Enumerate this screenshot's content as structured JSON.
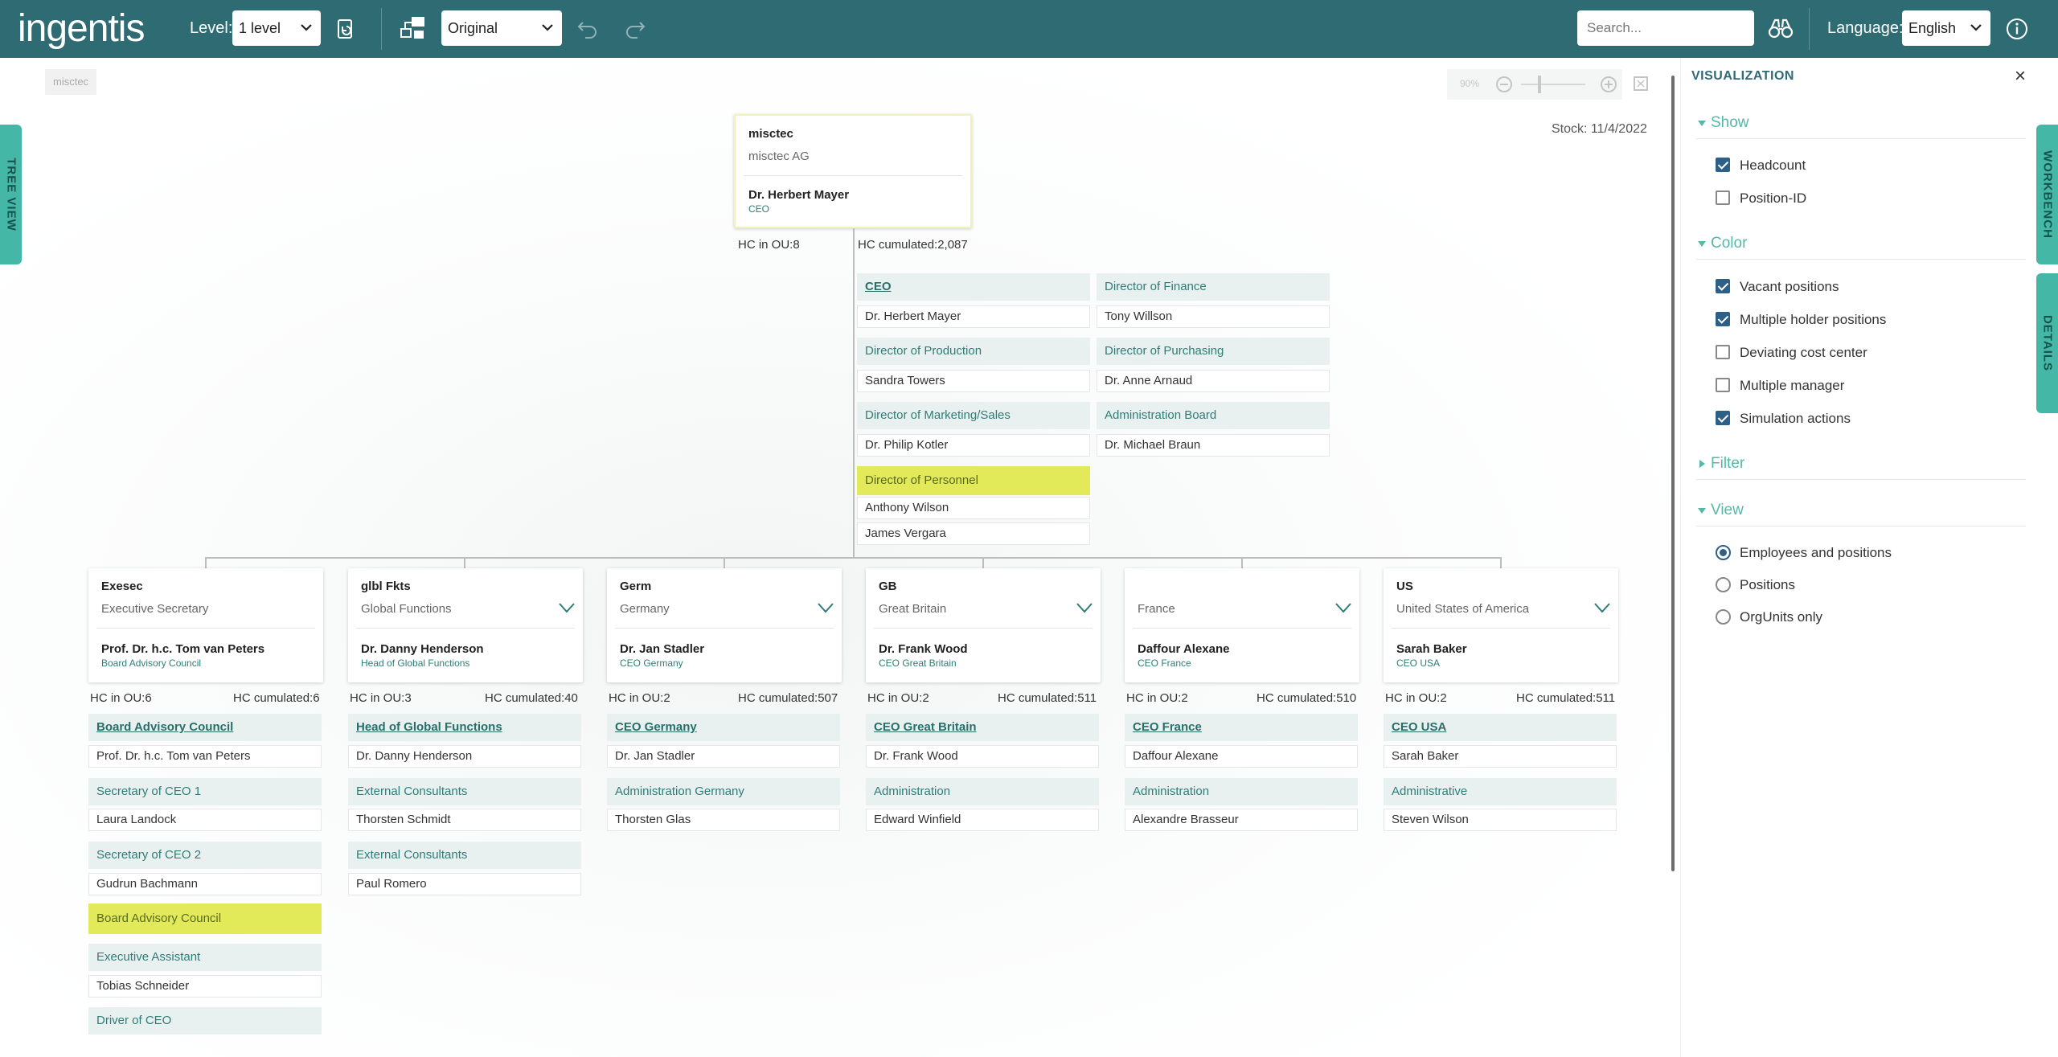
{
  "header": {
    "logo": "ingentis",
    "level_label": "Level:",
    "level_value": "1 level",
    "view_value": "Original",
    "search_placeholder": "Search...",
    "language_label": "Language:",
    "language_value": "English"
  },
  "sidetabs": {
    "tree_view": "TREE VIEW",
    "workbench": "WORKBENCH",
    "details": "DETAILS"
  },
  "canvas": {
    "breadcrumb": "misctec",
    "zoom_level": "90%",
    "stock": "Stock: 11/4/2022"
  },
  "root": {
    "abbr": "misctec",
    "full": "misctec AG",
    "person": "Dr. Herbert Mayer",
    "role": "CEO",
    "hc_ou": "HC in OU:8",
    "hc_cum": "HC cumulated:2,087",
    "left_col": [
      {
        "pos": "CEO",
        "emp": "Dr. Herbert Mayer"
      },
      {
        "pos": "Director of Production",
        "emp": "Sandra Towers"
      },
      {
        "pos": "Director of Marketing/Sales",
        "emp": "Dr. Philip Kotler"
      },
      {
        "pos": "Director of Personnel",
        "emps": [
          "Anthony Wilson",
          "James Vergara"
        ]
      }
    ],
    "right_col": [
      {
        "pos": "Director of Finance",
        "emp": "Tony Willson"
      },
      {
        "pos": "Director of Purchasing",
        "emp": "Dr. Anne Arnaud"
      },
      {
        "pos": "Administration Board",
        "emp": "Dr. Michael Braun"
      }
    ]
  },
  "units": [
    {
      "abbr": "Exesec",
      "full": "Executive Secretary",
      "person": "Prof. Dr. h.c. Tom van Peters",
      "role": "Board Advisory Council",
      "hc_ou": "HC in OU:6",
      "hc_cum": "HC cumulated:6",
      "positions": [
        {
          "pos": "Board Advisory Council",
          "emp": "Prof. Dr. h.c. Tom van Peters"
        },
        {
          "pos": "Secretary of CEO 1",
          "emp": "Laura Landock"
        },
        {
          "pos": "Secretary of CEO 2",
          "emp": "Gudrun Bachmann"
        },
        {
          "pos": "Board Advisory Council",
          "emp": ""
        },
        {
          "pos": "Executive Assistant",
          "emp": "Tobias Schneider"
        },
        {
          "pos": "Driver of CEO",
          "emp": ""
        }
      ]
    },
    {
      "abbr": "glbl Fkts",
      "full": "Global Functions",
      "person": "Dr. Danny Henderson",
      "role": "Head of Global Functions",
      "hc_ou": "HC in OU:3",
      "hc_cum": "HC cumulated:40",
      "positions": [
        {
          "pos": "Head of Global Functions",
          "emp": "Dr. Danny Henderson"
        },
        {
          "pos": "External Consultants",
          "emp": "Thorsten Schmidt"
        },
        {
          "pos": "External Consultants",
          "emp": "Paul Romero"
        }
      ]
    },
    {
      "abbr": "Germ",
      "full": "Germany",
      "person": "Dr. Jan Stadler",
      "role": "CEO Germany",
      "hc_ou": "HC in OU:2",
      "hc_cum": "HC cumulated:507",
      "positions": [
        {
          "pos": "CEO Germany",
          "emp": "Dr. Jan Stadler"
        },
        {
          "pos": "Administration Germany",
          "emp": "Thorsten Glas"
        }
      ]
    },
    {
      "abbr": "GB",
      "full": "Great Britain",
      "person": "Dr. Frank Wood",
      "role": "CEO Great Britain",
      "hc_ou": "HC in OU:2",
      "hc_cum": "HC cumulated:511",
      "positions": [
        {
          "pos": "CEO Great Britain",
          "emp": "Dr. Frank Wood"
        },
        {
          "pos": "Administration",
          "emp": "Edward Winfield"
        }
      ]
    },
    {
      "abbr": "",
      "full": "France",
      "person": "Daffour Alexane",
      "role": "CEO France",
      "hc_ou": "HC in OU:2",
      "hc_cum": "HC cumulated:510",
      "positions": [
        {
          "pos": "CEO France",
          "emp": "Daffour Alexane"
        },
        {
          "pos": "Administration",
          "emp": "Alexandre Brasseur"
        }
      ]
    },
    {
      "abbr": "US",
      "full": "United States of America",
      "person": "Sarah Baker",
      "role": "CEO USA",
      "hc_ou": "HC in OU:2",
      "hc_cum": "HC cumulated:511",
      "positions": [
        {
          "pos": "CEO USA",
          "emp": "Sarah Baker"
        },
        {
          "pos": "Administrative",
          "emp": "Steven Wilson"
        }
      ]
    }
  ],
  "panel": {
    "title": "VISUALIZATION",
    "show": {
      "label": "Show",
      "options": [
        {
          "label": "Headcount",
          "checked": true
        },
        {
          "label": "Position-ID",
          "checked": false
        }
      ]
    },
    "color": {
      "label": "Color",
      "options": [
        {
          "label": "Vacant positions",
          "checked": true
        },
        {
          "label": "Multiple holder positions",
          "checked": true
        },
        {
          "label": "Deviating cost center",
          "checked": false
        },
        {
          "label": "Multiple manager",
          "checked": false
        },
        {
          "label": "Simulation actions",
          "checked": true
        }
      ]
    },
    "filter": {
      "label": "Filter"
    },
    "view": {
      "label": "View",
      "options": [
        {
          "label": "Employees and positions",
          "selected": true
        },
        {
          "label": "Positions",
          "selected": false
        },
        {
          "label": "OrgUnits only",
          "selected": false
        }
      ]
    }
  },
  "colors": {
    "header": "#2f6b73",
    "accent": "#55b8a9",
    "highlight": "#e2ea5a",
    "position_bg": "#e8f1ef"
  }
}
